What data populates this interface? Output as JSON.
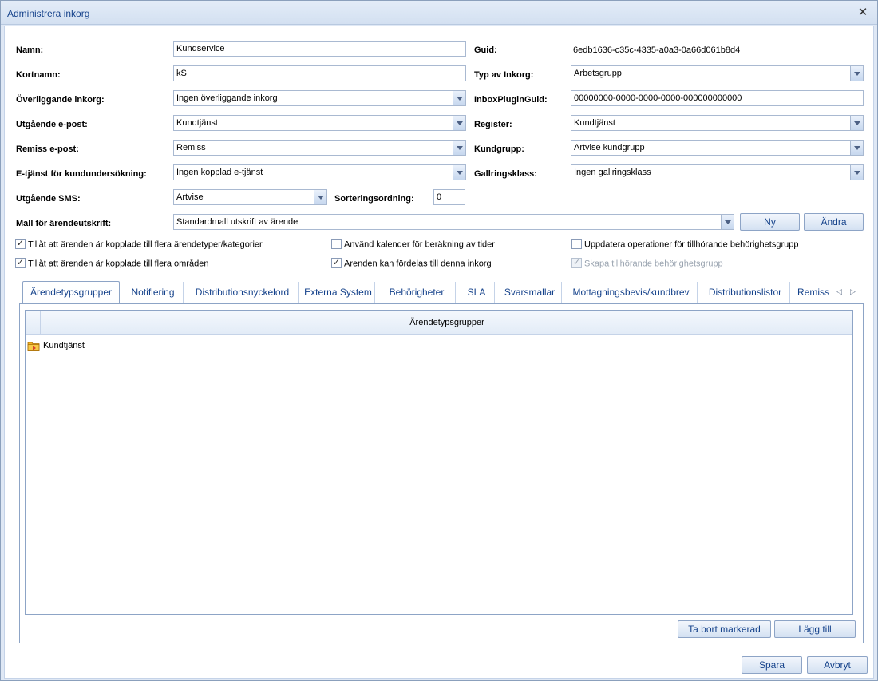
{
  "window": {
    "title": "Administrera inkorg"
  },
  "form": {
    "namn": {
      "label": "Namn:",
      "value": "Kundservice"
    },
    "guid": {
      "label": "Guid:",
      "value": "6edb1636-c35c-4335-a0a3-0a66d061b8d4"
    },
    "kortnamn": {
      "label": "Kortnamn:",
      "value": "kS"
    },
    "typ_av_inkorg": {
      "label": "Typ av Inkorg:",
      "value": "Arbetsgrupp"
    },
    "overliggande": {
      "label": "Överliggande inkorg:",
      "value": "Ingen överliggande inkorg"
    },
    "inbox_plugin": {
      "label": "InboxPluginGuid:",
      "value": "00000000-0000-0000-0000-000000000000"
    },
    "utgaende_epost": {
      "label": "Utgående e-post:",
      "value": "Kundtjänst"
    },
    "register": {
      "label": "Register:",
      "value": "Kundtjänst"
    },
    "remiss_epost": {
      "label": "Remiss e-post:",
      "value": "Remiss"
    },
    "kundgrupp": {
      "label": "Kundgrupp:",
      "value": "Artvise kundgrupp"
    },
    "etjanst": {
      "label": "E-tjänst för kundundersökning:",
      "value": "Ingen kopplad e-tjänst"
    },
    "gallringsklass": {
      "label": "Gallringsklass:",
      "value": "Ingen gallringsklass"
    },
    "utgaende_sms": {
      "label": "Utgående SMS:",
      "value": "Artvise"
    },
    "sorteringsordning": {
      "label": "Sorteringsordning:",
      "value": "0"
    },
    "mall": {
      "label": "Mall för ärendeutskrift:",
      "value": "Standardmall utskrift av ärende"
    },
    "ny_button": "Ny",
    "andra_button": "Ändra"
  },
  "checkboxes": [
    {
      "label": "Tillåt att ärenden är kopplade till flera ärendetyper/kategorier",
      "checked": true,
      "mark": "✓"
    },
    {
      "label": "Använd kalender för beräkning av tider",
      "checked": false,
      "mark": ""
    },
    {
      "label": "Uppdatera operationer för tillhörande behörighetsgrupp",
      "checked": false,
      "mark": ""
    },
    {
      "label": "Tillåt att ärenden är kopplade till flera områden",
      "checked": true,
      "mark": "✓"
    },
    {
      "label": "Ärenden kan fördelas till denna inkorg",
      "checked": true,
      "mark": "✓"
    },
    {
      "label": "Skapa tillhörande behörighetsgrupp",
      "checked": true,
      "disabled": true,
      "mark": "✓"
    }
  ],
  "tabs": [
    "Ärendetypsgrupper",
    "Notifiering",
    "Distributionsnyckelord",
    "Externa System",
    "Behörigheter",
    "SLA",
    "Svarsmallar",
    "Mottagningsbevis/kundbrev",
    "Distributionslistor",
    "Remiss"
  ],
  "grid": {
    "column": "Ärendetypsgrupper",
    "rows": [
      {
        "label": "Kundtjänst",
        "icon": "folder-icon"
      }
    ]
  },
  "panel_buttons": {
    "remove": "Ta bort markerad",
    "add": "Lägg till"
  },
  "footer": {
    "save": "Spara",
    "cancel": "Avbryt"
  }
}
